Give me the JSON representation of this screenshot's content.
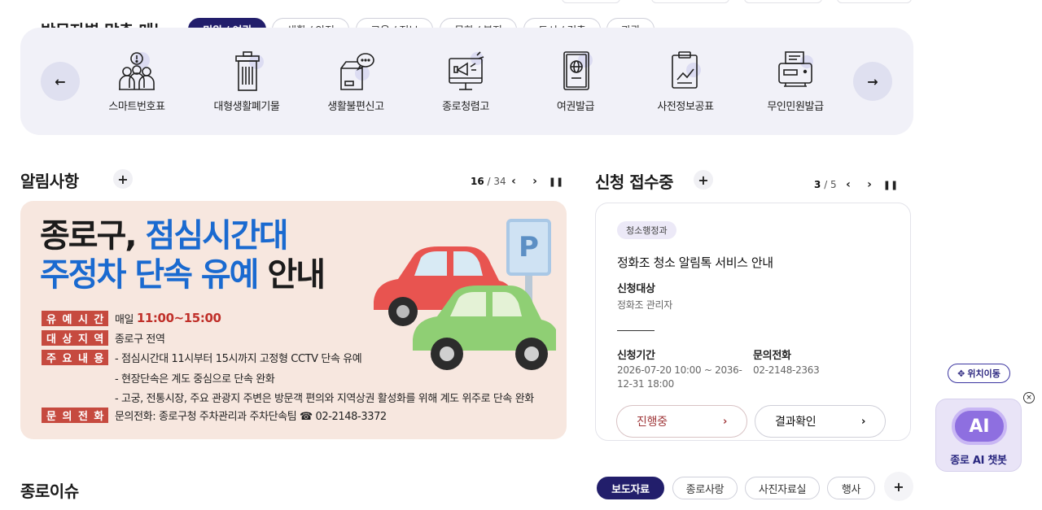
{
  "visitor_menu": {
    "title": "방문자별 맞춤 메뉴",
    "tabs": [
      {
        "label": "민원 / 여권",
        "active": true
      },
      {
        "label": "생활 / 안전",
        "active": false
      },
      {
        "label": "교육 / 정보",
        "active": false
      },
      {
        "label": "문화 / 복지",
        "active": false
      },
      {
        "label": "도시 / 건축",
        "active": false
      },
      {
        "label": "관광",
        "active": false
      }
    ],
    "prev_label": "←",
    "next_label": "→",
    "items": [
      {
        "label": "스마트번호표",
        "icon": "queue-ticket-icon"
      },
      {
        "label": "대형생활폐기물",
        "icon": "trash-bin-icon"
      },
      {
        "label": "생활불편신고",
        "icon": "complaint-box-icon"
      },
      {
        "label": "종로청렴고",
        "icon": "megaphone-monitor-icon"
      },
      {
        "label": "여권발급",
        "icon": "passport-icon"
      },
      {
        "label": "사전정보공표",
        "icon": "clipboard-chart-icon"
      },
      {
        "label": "무인민원발급",
        "icon": "kiosk-printer-icon"
      }
    ]
  },
  "notices": {
    "title": "알림사항",
    "plus_label": "+",
    "pager_current": "16",
    "pager_total": "/ 34",
    "banner": {
      "line1_dark": "종로구,",
      "line1_blue": "점심시간대",
      "line2_blue": "주정차 단속 유예",
      "line2_dark": "안내",
      "sign_letter": "P",
      "rows": [
        {
          "tag": [
            "유",
            "예",
            "시",
            "간"
          ],
          "prefix": "매일",
          "highlight": "11:00~15:00",
          "text": ""
        },
        {
          "tag": [
            "대",
            "상",
            "지",
            "역"
          ],
          "prefix": "",
          "highlight": "",
          "text": "종로구 전역"
        },
        {
          "tag": [
            "주",
            "요",
            "내",
            "용"
          ],
          "prefix": "",
          "highlight": "",
          "text": "- 점심시간대 11시부터 15시까지 고정형 CCTV 단속 유예"
        }
      ],
      "sub_lines": [
        "- 현장단속은 계도 중심으로 단속 완화",
        "- 고궁, 전통시장, 주요 관광지 주변은 방문객 편의와 지역상권 활성화를 위해 계도 위주로 단속 완화"
      ],
      "contact_tag": [
        "문",
        "의",
        "전",
        "화"
      ],
      "contact_text": "문의전화: 종로구청 주차관리과 주차단속팀 ☎ 02-2148-3372"
    }
  },
  "applications": {
    "title": "신청 접수중",
    "plus_label": "+",
    "pager_current": "3",
    "pager_total": "/ 5",
    "dept": "청소행정과",
    "item_title": "정화조 청소 알림톡 서비스 안내",
    "target_label": "신청대상",
    "target_value": "정화조 관리자",
    "period_label": "신청기간",
    "period_value": "2026-07-20 10:00 ~ 2036-12-31 18:00",
    "phone_label": "문의전화",
    "phone_value": "02-2148-2363",
    "btn_progress": "진행중",
    "btn_result": "결과확인"
  },
  "floating": {
    "move_label": "위치이동",
    "chatbot_ai": "AI",
    "chatbot_label": "종로 AI 챗봇",
    "close_label": "×"
  },
  "issues": {
    "title": "종로이슈",
    "tabs": [
      {
        "label": "보도자료",
        "active": true
      },
      {
        "label": "종로사랑",
        "active": false
      },
      {
        "label": "사진자료실",
        "active": false
      },
      {
        "label": "행사",
        "active": false
      }
    ],
    "plus_label": "+"
  },
  "colors": {
    "navy": "#221e6b",
    "banner_bg": "#f7e7df",
    "blue_text": "#1a6ad0",
    "tag_red": "#c64a3f",
    "menu_bg": "#f1f1f8"
  }
}
